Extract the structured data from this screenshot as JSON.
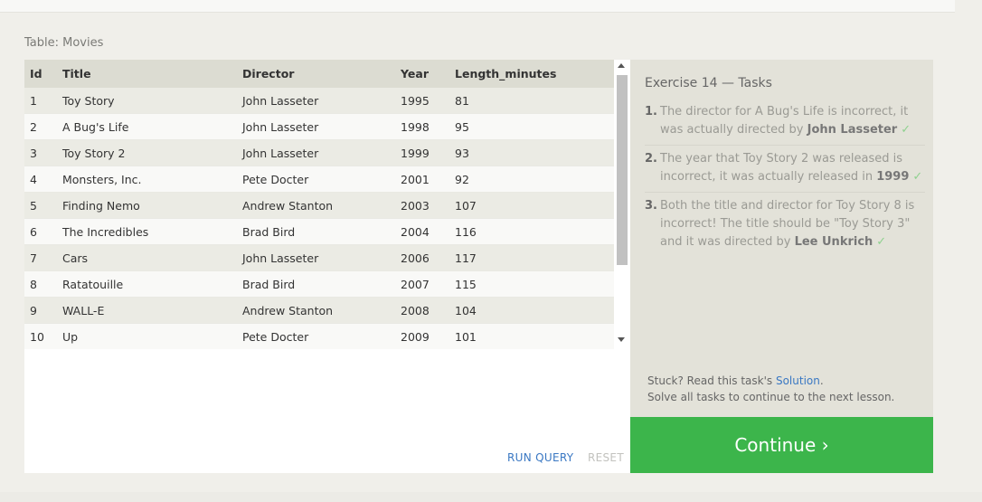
{
  "table_label": "Table: Movies",
  "table": {
    "columns": [
      "Id",
      "Title",
      "Director",
      "Year",
      "Length_minutes"
    ],
    "rows": [
      [
        "1",
        "Toy Story",
        "John Lasseter",
        "1995",
        "81"
      ],
      [
        "2",
        "A Bug's Life",
        "John Lasseter",
        "1998",
        "95"
      ],
      [
        "3",
        "Toy Story 2",
        "John Lasseter",
        "1999",
        "93"
      ],
      [
        "4",
        "Monsters, Inc.",
        "Pete Docter",
        "2001",
        "92"
      ],
      [
        "5",
        "Finding Nemo",
        "Andrew Stanton",
        "2003",
        "107"
      ],
      [
        "6",
        "The Incredibles",
        "Brad Bird",
        "2004",
        "116"
      ],
      [
        "7",
        "Cars",
        "John Lasseter",
        "2006",
        "117"
      ],
      [
        "8",
        "Ratatouille",
        "Brad Bird",
        "2007",
        "115"
      ],
      [
        "9",
        "WALL-E",
        "Andrew Stanton",
        "2008",
        "104"
      ],
      [
        "10",
        "Up",
        "Pete Docter",
        "2009",
        "101"
      ]
    ]
  },
  "buttons": {
    "run_query": "RUN QUERY",
    "reset": "RESET"
  },
  "tasks": {
    "title": "Exercise 14 — Tasks",
    "items": [
      {
        "num": "1.",
        "text": "The director for A Bug's Life is incorrect, it was actually directed by ",
        "bold": "John Lasseter",
        "check": "✓"
      },
      {
        "num": "2.",
        "text": "The year that Toy Story 2 was released is incorrect, it was actually released in ",
        "bold": "1999",
        "check": "✓"
      },
      {
        "num": "3.",
        "text": "Both the title and director for Toy Story 8 is incorrect! The title should be \"Toy Story 3\" and it was directed by ",
        "bold": "Lee Unkrich",
        "check": "✓"
      }
    ]
  },
  "help": {
    "stuck_prefix": "Stuck? Read this task's ",
    "solution_link": "Solution",
    "stuck_suffix": ".",
    "solve_all": "Solve all tasks to continue to the next lesson."
  },
  "continue_label": "Continue ›",
  "colors": {
    "accent_green": "#3cb54b",
    "link_blue": "#3a78c3"
  }
}
